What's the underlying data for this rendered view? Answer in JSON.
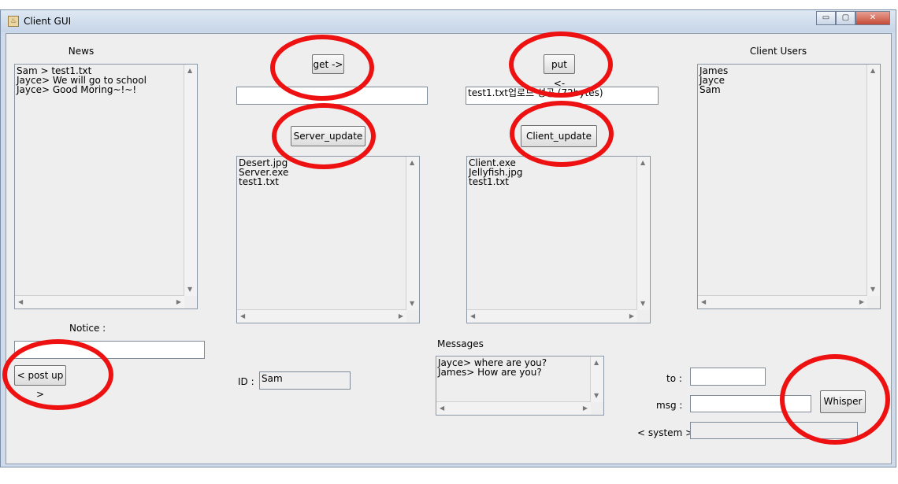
{
  "window": {
    "title": "Client GUI",
    "buttons": {
      "minimize": "▭",
      "maximize": "▢",
      "close": "✕"
    }
  },
  "news": {
    "label": "News",
    "items": [
      "Sam > test1.txt",
      "Jayce> We will go to school",
      "Jayce> Good Moring~!~!"
    ]
  },
  "notice": {
    "label": "Notice :",
    "value": "",
    "post_button": "< post up >"
  },
  "server": {
    "get_button": "get ->",
    "path_value": "",
    "update_button": "Server_update",
    "files": [
      "Desert.jpg",
      "Server.exe",
      "test1.txt"
    ]
  },
  "client": {
    "put_button": "put <-",
    "path_value": "test1.txt업로드 성공 (72bytes)",
    "update_button": "Client_update",
    "files": [
      "Client.exe",
      "Jellyfish.jpg",
      "test1.txt"
    ]
  },
  "users": {
    "label": "Client Users",
    "items": [
      "James",
      "Jayce",
      "Sam"
    ]
  },
  "id": {
    "label": "ID :",
    "value": "Sam"
  },
  "messages": {
    "label": "Messages",
    "items": [
      "Jayce> where are you?",
      "James> How are you?"
    ]
  },
  "whisper": {
    "to_label": "to :",
    "to_value": "",
    "msg_label": "msg :",
    "msg_value": "",
    "system_label": "< system >",
    "system_value": "",
    "button": "Whisper"
  },
  "colors": {
    "annotation_ring": "#ee1111"
  }
}
